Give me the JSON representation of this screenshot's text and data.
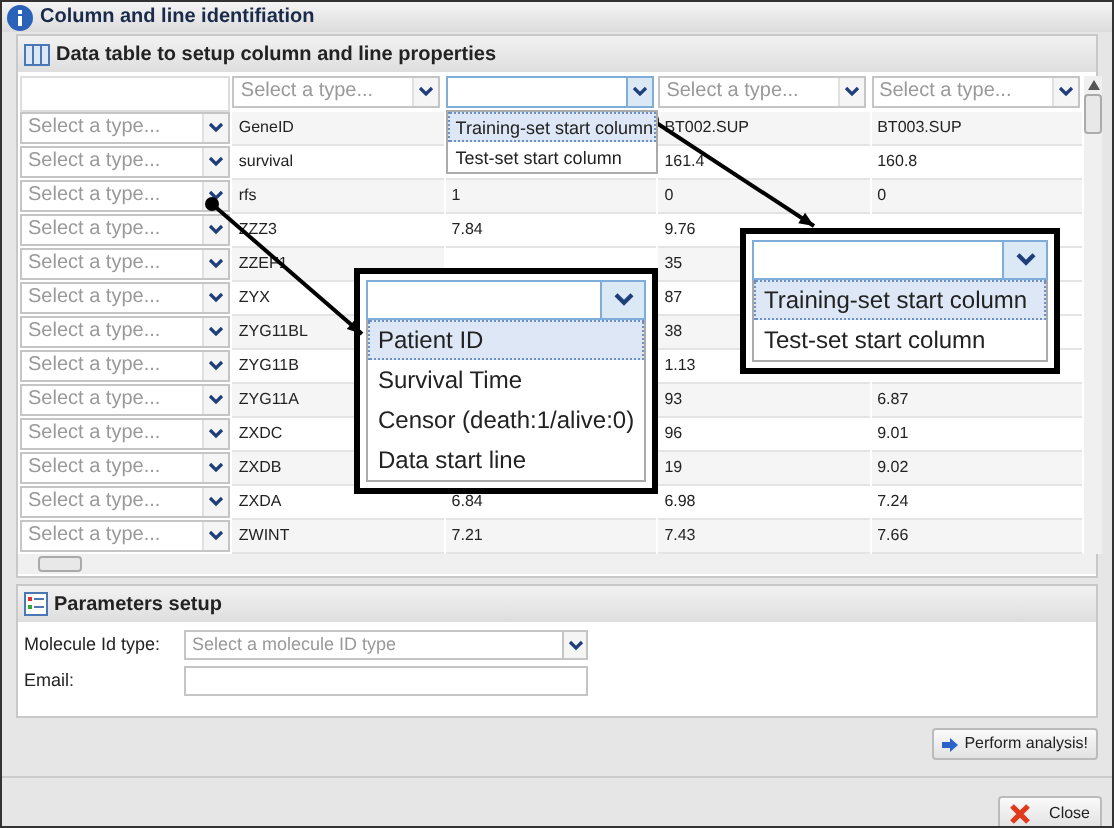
{
  "window": {
    "title": "Column and line identifiation"
  },
  "data_panel": {
    "title": "Data table to setup column and line properties"
  },
  "column_selects": [
    {
      "placeholder": "Select a type...",
      "open": false
    },
    {
      "open": true,
      "options": [
        {
          "label": "Training-set start column",
          "selected": true
        },
        {
          "label": "Test-set start column",
          "selected": false
        }
      ]
    },
    {
      "placeholder": "Select a type...",
      "open": false
    },
    {
      "placeholder": "Select a type...",
      "open": false
    }
  ],
  "rows": [
    {
      "placeholder": "Select a type...",
      "cells": [
        "GeneID",
        null,
        "BT002.SUP",
        "BT003.SUP"
      ]
    },
    {
      "placeholder": "Select a type...",
      "cells": [
        "survival",
        null,
        "161.4",
        "160.8"
      ]
    },
    {
      "placeholder": "Select a type...",
      "cells": [
        "rfs",
        "1",
        "0",
        "0"
      ]
    },
    {
      "placeholder": "Select a type...",
      "cells": [
        "ZZZ3",
        "7.84",
        "9.76",
        null
      ]
    },
    {
      "placeholder": "Select a type...",
      "cells": [
        "ZZEF1",
        null,
        "35",
        null
      ]
    },
    {
      "placeholder": "Select a type...",
      "cells": [
        "ZYX",
        null,
        "87",
        null
      ]
    },
    {
      "placeholder": "Select a type...",
      "cells": [
        "ZYG11BL",
        null,
        "38",
        null
      ]
    },
    {
      "placeholder": "Select a type...",
      "cells": [
        "ZYG11B",
        null,
        "1.13",
        null
      ]
    },
    {
      "placeholder": "Select a type...",
      "cells": [
        "ZYG11A",
        null,
        "93",
        "6.87"
      ]
    },
    {
      "placeholder": "Select a type...",
      "cells": [
        "ZXDC",
        null,
        "96",
        "9.01"
      ]
    },
    {
      "placeholder": "Select a type...",
      "cells": [
        "ZXDB",
        null,
        "19",
        "9.02"
      ]
    },
    {
      "placeholder": "Select a type...",
      "cells": [
        "ZXDA",
        "6.84",
        "6.98",
        "7.24"
      ]
    },
    {
      "placeholder": "Select a type...",
      "cells": [
        "ZWINT",
        "7.21",
        "7.43",
        "7.66"
      ]
    }
  ],
  "callouts": [
    {
      "options": [
        {
          "label": "Patient ID",
          "selected": true
        },
        {
          "label": "Survival Time",
          "selected": false
        },
        {
          "label": "Censor (death:1/alive:0)",
          "selected": false
        },
        {
          "label": "Data start line",
          "selected": false
        }
      ]
    },
    {
      "options": [
        {
          "label": "Training-set start column",
          "selected": true
        },
        {
          "label": "Test-set start column",
          "selected": false
        }
      ]
    }
  ],
  "parameters": {
    "title": "Parameters setup",
    "fields": [
      {
        "label": "Molecule Id type:",
        "kind": "select",
        "placeholder": "Select a molecule ID type"
      },
      {
        "label": "Email:",
        "kind": "text"
      }
    ]
  },
  "buttons": {
    "perform": "Perform analysis!",
    "close": "Close"
  }
}
